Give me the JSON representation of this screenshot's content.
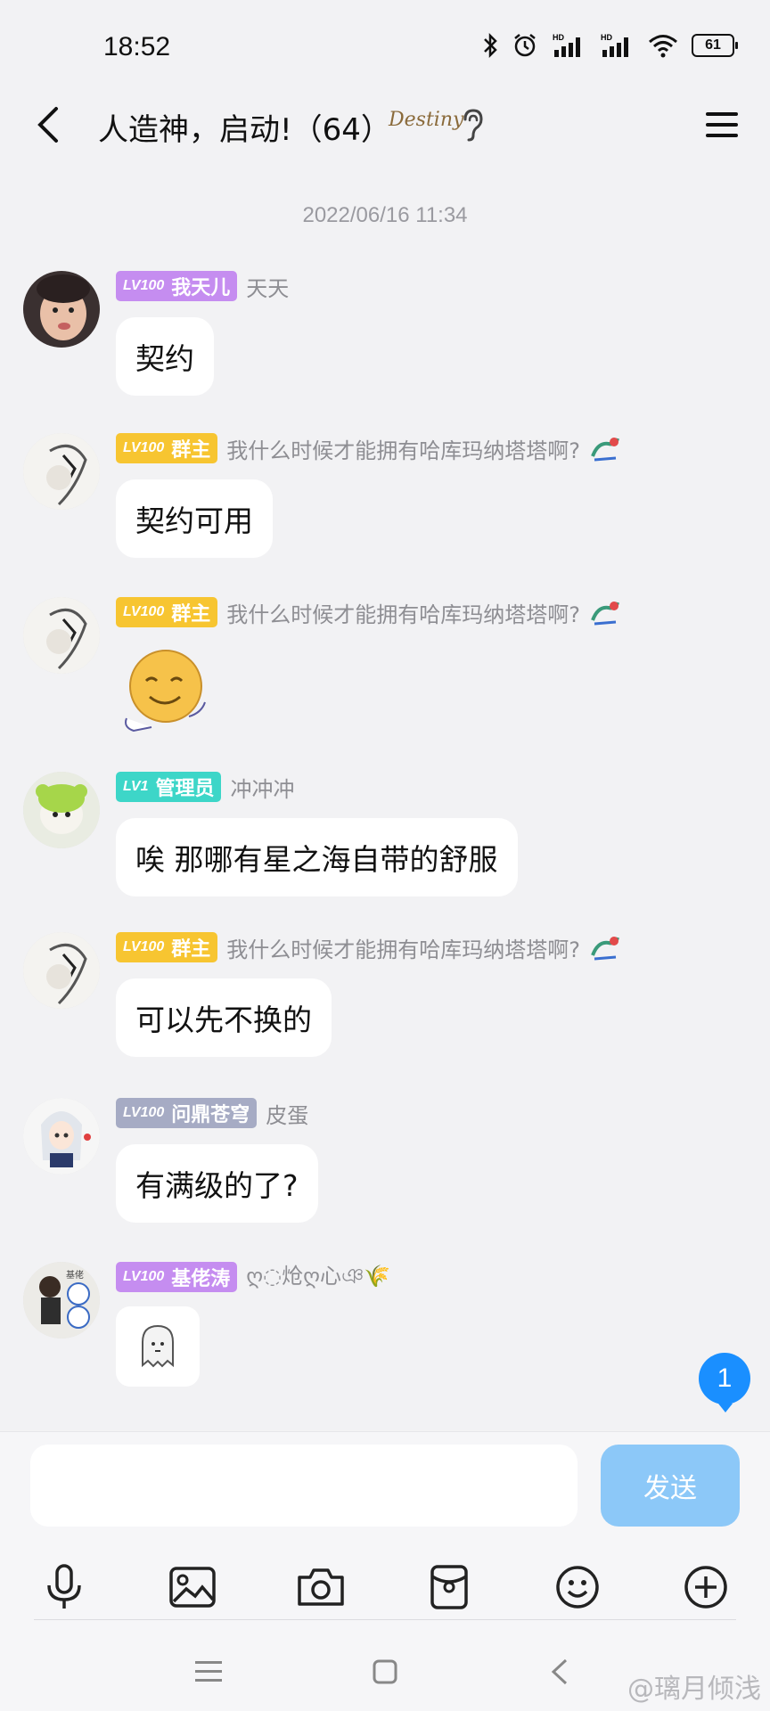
{
  "status_bar": {
    "time": "18:52",
    "battery": "61"
  },
  "header": {
    "title": "人造神，启动!（64）",
    "badge_text": "Destiny"
  },
  "timestamp": "2022/06/16 11:34",
  "messages": [
    {
      "level": "LV100",
      "role": "我天儿",
      "badge_color": "#c58df0",
      "nickname": "天天",
      "text": "契约"
    },
    {
      "level": "LV100",
      "role": "群主",
      "badge_color": "#f7c531",
      "nickname": "我什么时候才能拥有哈库玛纳塔塔啊?",
      "text": "契约可用"
    },
    {
      "level": "LV100",
      "role": "群主",
      "badge_color": "#f7c531",
      "nickname": "我什么时候才能拥有哈库玛纳塔塔啊?",
      "text": ""
    },
    {
      "level": "LV1",
      "role": "管理员",
      "badge_color": "#3dd6c8",
      "nickname": "冲冲冲",
      "text": "唉 那哪有星之海自带的舒服"
    },
    {
      "level": "LV100",
      "role": "群主",
      "badge_color": "#f7c531",
      "nickname": "我什么时候才能拥有哈库玛纳塔塔啊?",
      "text": "可以先不换的"
    },
    {
      "level": "LV100",
      "role": "问鼎苍穹",
      "badge_color": "#a6abc4",
      "nickname": "皮蛋",
      "text": "有满级的了?"
    },
    {
      "level": "LV100",
      "role": "基佬涛",
      "badge_color": "#c58df0",
      "nickname": "ღ◌炝ღ心ঞ🌾",
      "text": ""
    }
  ],
  "unread_count": "1",
  "composer": {
    "send_label": "发送",
    "input_value": ""
  },
  "watermark": "@璃月倾浅"
}
